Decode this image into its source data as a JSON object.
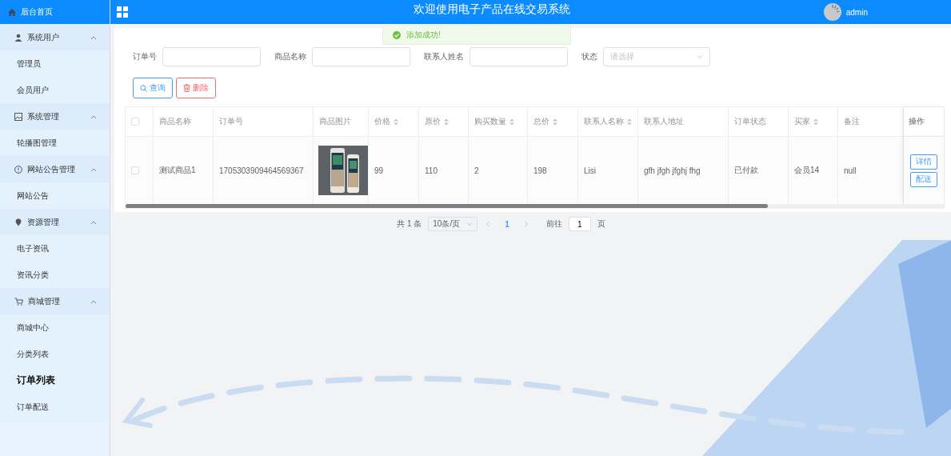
{
  "header": {
    "home": "后台首页",
    "title": "欢迎使用电子产品在线交易系统",
    "user": "admin"
  },
  "toast": {
    "message": "添加成功!"
  },
  "sidebar": {
    "groups": [
      {
        "label": "系统用户",
        "expanded": true,
        "children": [
          {
            "label": "管理员",
            "selected": false
          },
          {
            "label": "会员用户",
            "selected": false
          }
        ]
      },
      {
        "label": "系统管理",
        "expanded": true,
        "children": [
          {
            "label": "轮播图管理",
            "selected": false
          }
        ]
      },
      {
        "label": "网站公告管理",
        "expanded": true,
        "children": [
          {
            "label": "网站公告",
            "selected": false
          }
        ]
      },
      {
        "label": "资源管理",
        "expanded": true,
        "children": [
          {
            "label": "电子资讯",
            "selected": false
          },
          {
            "label": "资讯分类",
            "selected": false
          }
        ]
      },
      {
        "label": "商城管理",
        "expanded": true,
        "children": [
          {
            "label": "商城中心",
            "selected": false
          },
          {
            "label": "分类列表",
            "selected": false
          },
          {
            "label": "订单列表",
            "selected": true
          },
          {
            "label": "订单配送",
            "selected": false
          }
        ]
      }
    ]
  },
  "filters": [
    {
      "kind": "input",
      "label": "订单号"
    },
    {
      "kind": "input",
      "label": "商品名称"
    },
    {
      "kind": "input",
      "label": "联系人姓名"
    },
    {
      "kind": "select",
      "label": "状态",
      "placeholder": "请选择"
    }
  ],
  "actions": [
    {
      "kind": "search",
      "label": "查询"
    },
    {
      "kind": "delete",
      "label": "删除"
    }
  ],
  "table": {
    "all_checked": false,
    "columns": [
      {
        "label": "商品名称",
        "sortable": false
      },
      {
        "label": "订单号",
        "sortable": false
      },
      {
        "label": "商品图片",
        "sortable": false
      },
      {
        "label": "价格",
        "sortable": true
      },
      {
        "label": "原价",
        "sortable": true
      },
      {
        "label": "购买数量",
        "sortable": true
      },
      {
        "label": "总价",
        "sortable": true
      },
      {
        "label": "联系人名称",
        "sortable": true
      },
      {
        "label": "联系人地址",
        "sortable": false
      },
      {
        "label": "订单状态",
        "sortable": false
      },
      {
        "label": "买家",
        "sortable": true
      },
      {
        "label": "备注",
        "sortable": false
      },
      {
        "label": "操作",
        "sortable": false
      }
    ],
    "rows": [
      {
        "checked": false,
        "cells": [
          "测试商品1",
          "1705303909464569367",
          {
            "kind": "picture"
          },
          "99",
          "110",
          "2",
          "198",
          "Lisi",
          "gfh jfgh jfghj fhg",
          "已付款",
          "会员14",
          "null"
        ],
        "buttons": [
          "详情",
          "配送"
        ]
      }
    ]
  },
  "pagination": {
    "total": "共 1 条",
    "page_size": "10条/页",
    "pages": [
      {
        "label": "1",
        "selected": true
      }
    ],
    "goto_label": "前往",
    "goto_value": "1",
    "goto_suffix": "页"
  }
}
